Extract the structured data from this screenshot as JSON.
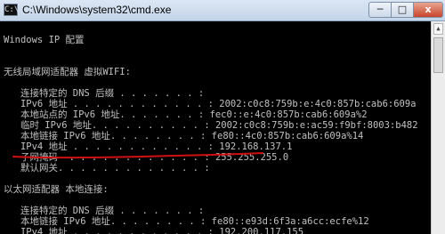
{
  "window": {
    "title": "C:\\Windows\\system32\\cmd.exe",
    "icon_text": "C:\\",
    "min_glyph": "─",
    "max_glyph": "□",
    "close_glyph": "x"
  },
  "console": {
    "lines": [
      "Windows IP 配置",
      "",
      "",
      "无线局域网适配器 虚拟WIFI:",
      "",
      "   连接特定的 DNS 后缀 . . . . . . . :",
      "   IPv6 地址 . . . . . . . . . . . . : 2002:c0c8:759b:e:4c0:857b:cab6:609a",
      "   本地站点的 IPv6 地址. . . . . . . : fec0::e:4c0:857b:cab6:609a%2",
      "   临时 IPv6 地址. . . . . . . . . . : 2002:c0c8:759b:e:ac59:f9bf:8003:b482",
      "   本地链接 IPv6 地址. . . . . . . . : fe80::4c0:857b:cab6:609a%14",
      "   IPv4 地址 . . . . . . . . . . . . : 192.168.137.1",
      "   子网掩码  . . . . . . . . . . . . : 255.255.255.0",
      "   默认网关. . . . . . . . . . . . . :",
      "",
      "以太网适配器 本地连接:",
      "",
      "   连接特定的 DNS 后缀 . . . . . . . :",
      "   本地链接 IPv6 地址. . . . . . . . : fe80::e93d:6f3a:a6cc:ecfe%12",
      "   IPv4 地址 . . . . . . . . . . . . : 192.200.117.155"
    ]
  },
  "colors": {
    "console_text": "#c0c0c0",
    "annotation_red": "#d01010"
  }
}
